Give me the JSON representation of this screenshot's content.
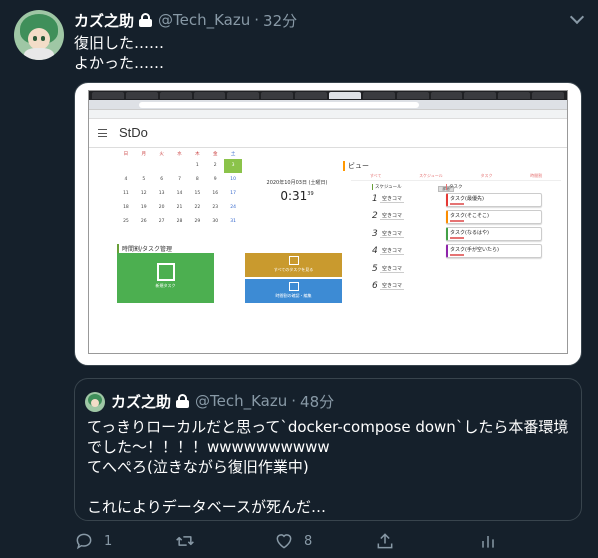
{
  "tweet": {
    "author_name": "カズ之助",
    "handle": "@Tech_Kazu",
    "separator": "·",
    "time": "32分",
    "text_line1": "復旧した……",
    "text_line2": "よかった……"
  },
  "screenshot": {
    "app_title": "StDo",
    "calendar": {
      "weekdays": [
        "日",
        "月",
        "火",
        "水",
        "木",
        "金",
        "土"
      ],
      "weeks": [
        [
          "",
          "",
          "",
          "",
          "1",
          "2",
          "3"
        ],
        [
          "4",
          "5",
          "6",
          "7",
          "8",
          "9",
          "10"
        ],
        [
          "11",
          "12",
          "13",
          "14",
          "15",
          "16",
          "17"
        ],
        [
          "18",
          "19",
          "20",
          "21",
          "22",
          "23",
          "24"
        ],
        [
          "25",
          "26",
          "27",
          "28",
          "29",
          "30",
          "31"
        ]
      ],
      "today": "3"
    },
    "clock_date": "2020年10月03日 (土曜日)",
    "clock_time": "0:31",
    "clock_seconds": "39",
    "section_title": "時間割/タスク管理",
    "tile_green_label": "新規タスク",
    "tile_gold_label": "すべてのタスクを見る",
    "tile_blue_label": "時間割の確認・編集",
    "view_title": "ビュー",
    "view_tabs": [
      "すべて",
      "スケジュール",
      "タスク",
      "時間割"
    ],
    "schedule_caption": "スケジュール",
    "schedule_button": "詳細",
    "schedule_rows": [
      {
        "num": "1",
        "label": "空きコマ"
      },
      {
        "num": "2",
        "label": "空きコマ"
      },
      {
        "num": "3",
        "label": "空きコマ"
      },
      {
        "num": "4",
        "label": "空きコマ"
      },
      {
        "num": "5",
        "label": "空きコマ"
      },
      {
        "num": "6",
        "label": "空きコマ"
      }
    ],
    "task_caption": "タスク",
    "tasks": [
      "タスク(最優先)",
      "タスク(そこそこ)",
      "タスク(なるはや)",
      "タスク(手が空いたら)"
    ]
  },
  "quoted": {
    "author_name": "カズ之助",
    "handle": "@Tech_Kazu",
    "separator": "·",
    "time": "48分",
    "line1": "てっきりローカルだと思って`docker-compose down`したら本番環境",
    "line2": "でした〜！！！！wwwwwwwwww",
    "line3": "てへぺろ(泣きながら復旧作業中)",
    "line4": "これによりデータベースが死んだ…"
  },
  "actions": {
    "reply_count": "1",
    "retweet_count": "",
    "like_count": "8"
  },
  "colors": {
    "background": "#15202b",
    "secondary_text": "#8899a6",
    "border": "#38444d"
  }
}
